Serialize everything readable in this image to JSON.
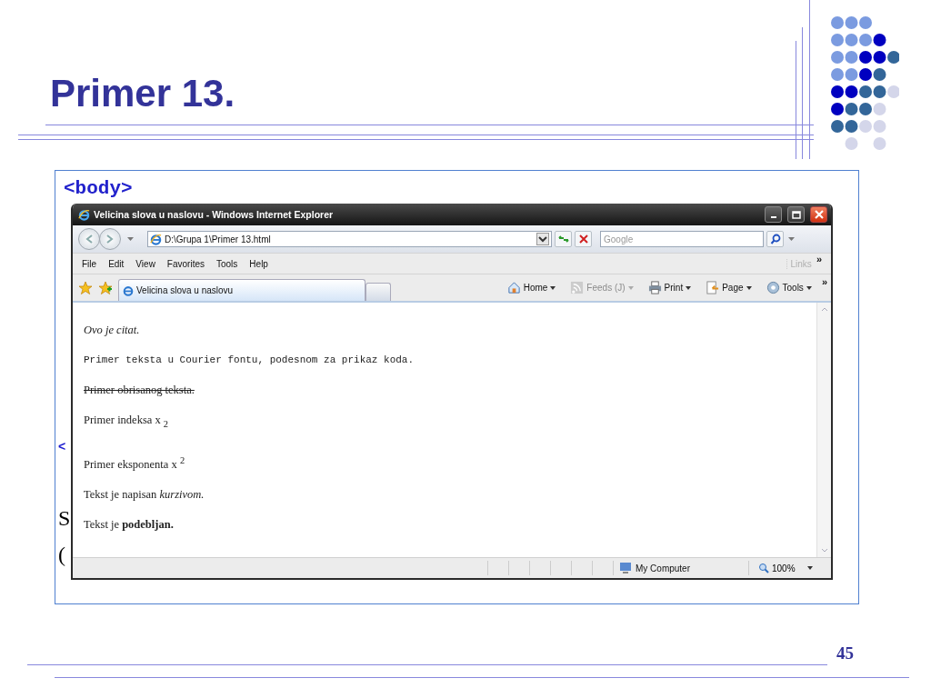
{
  "slide": {
    "title": "Primer 13.",
    "code_tag": "<body>",
    "fragments": [
      {
        "kind": "arrow",
        "text": "<"
      },
      {
        "kind": "letter",
        "text": "S"
      },
      {
        "kind": "letter",
        "text": "("
      }
    ],
    "page_number": "45"
  },
  "browser": {
    "title": "Velicina slova u naslovu - Windows Internet Explorer",
    "address": "D:\\Grupa 1\\Primer 13.html",
    "search_placeholder": "Google",
    "menu": [
      "File",
      "Edit",
      "View",
      "Favorites",
      "Tools",
      "Help"
    ],
    "links_label": "Links",
    "links_chevron": "»",
    "tab": {
      "label": "Velicina slova u naslovu",
      "selected": true
    },
    "commands": [
      {
        "label": "Home",
        "kind": "home",
        "disabled": false
      },
      {
        "label": "Feeds (J)",
        "kind": "feed",
        "disabled": true
      },
      {
        "label": "Print",
        "kind": "print",
        "disabled": false
      },
      {
        "label": "Page",
        "kind": "page",
        "disabled": false
      },
      {
        "label": "Tools",
        "kind": "tools",
        "disabled": false
      }
    ],
    "commands_chevron": "»",
    "content": [
      {
        "kind": "italic",
        "text": "Ovo je citat."
      },
      {
        "kind": "code",
        "text": "Primer teksta u Courier fontu, podesnom za prikaz koda."
      },
      {
        "kind": "deleted",
        "text": "Primer obrisanog teksta."
      },
      {
        "kind": "plain",
        "text": "Primer indeksa x $_{2}$"
      },
      {
        "kind": "plain",
        "text": "Primer eksponenta x $^{2}$"
      },
      {
        "kind": "plain",
        "text": "Tekst je napisan *kurzivom.*"
      },
      {
        "kind": "plain",
        "text": "Tekst je **podebljan.**"
      }
    ],
    "status": {
      "zone": "My Computer",
      "zoom": "100%"
    }
  }
}
